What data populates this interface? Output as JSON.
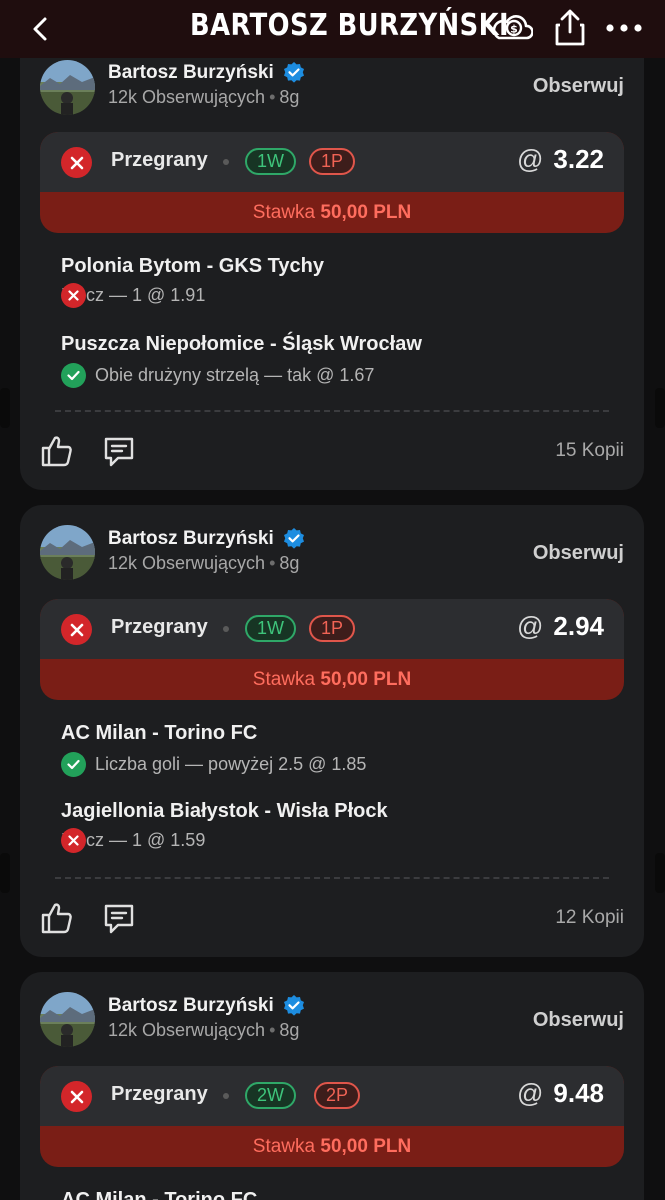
{
  "header": {
    "title": "BARTOSZ BURZYŃSKI",
    "background": "#1f0d0e"
  },
  "colors": {
    "loss_red": "#d3262a",
    "win_green": "#22a15a",
    "stake_bar": "#7a1e16",
    "card_bg": "#1d1e20"
  },
  "posts": [
    {
      "author": "Bartosz Burzyński",
      "followers": "12k Obserwujących",
      "time": "8g",
      "follow_label": "Obserwuj",
      "status": "Przegrany",
      "wins": "1W",
      "losses": "1P",
      "odds_symbol": "@",
      "odds": "3.22",
      "stake_label": "Stawka",
      "stake_value": "50,00 PLN",
      "selections": [
        {
          "match": "Polonia Bytom - GKS Tychy",
          "pick": "Mecz — 1 @ 1.91",
          "result": "lost"
        },
        {
          "match": "Puszcza Niepołomice - Śląsk Wrocław",
          "pick": "Obie drużyny strzelą — tak @ 1.67",
          "result": "won"
        }
      ],
      "copies": "15 Kopii"
    },
    {
      "author": "Bartosz Burzyński",
      "followers": "12k Obserwujących",
      "time": "8g",
      "follow_label": "Obserwuj",
      "status": "Przegrany",
      "wins": "1W",
      "losses": "1P",
      "odds_symbol": "@",
      "odds": "2.94",
      "stake_label": "Stawka",
      "stake_value": "50,00 PLN",
      "selections": [
        {
          "match": "AC Milan - Torino FC",
          "pick": "Liczba goli — powyżej 2.5 @ 1.85",
          "result": "won"
        },
        {
          "match": "Jagiellonia Białystok - Wisła Płock",
          "pick": "Mecz — 1 @ 1.59",
          "result": "lost"
        }
      ],
      "copies": "12 Kopii"
    },
    {
      "author": "Bartosz Burzyński",
      "followers": "12k Obserwujących",
      "time": "8g",
      "follow_label": "Obserwuj",
      "status": "Przegrany",
      "wins": "2W",
      "losses": "2P",
      "odds_symbol": "@",
      "odds": "9.48",
      "stake_label": "Stawka",
      "stake_value": "50,00 PLN",
      "selections": [
        {
          "match": "AC Milan - Torino FC"
        }
      ]
    }
  ]
}
